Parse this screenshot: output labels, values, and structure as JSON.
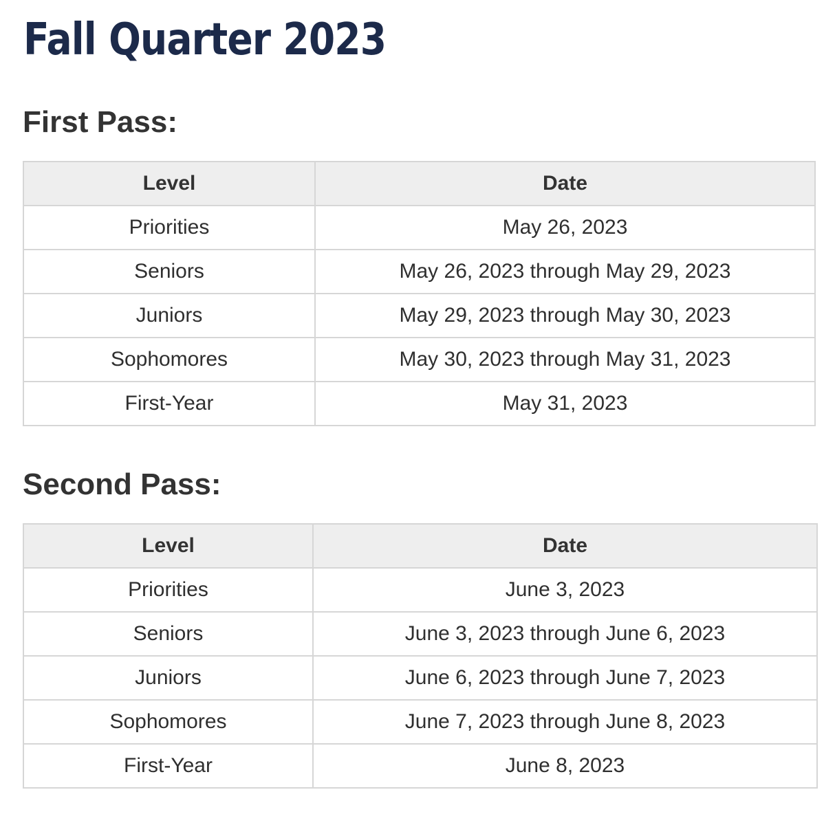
{
  "title": "Fall Quarter 2023",
  "first_pass": {
    "heading": "First Pass:",
    "columns": [
      "Level",
      "Date"
    ],
    "rows": [
      {
        "level": "Priorities",
        "date": "May 26, 2023"
      },
      {
        "level": "Seniors",
        "date": "May 26, 2023 through May 29, 2023"
      },
      {
        "level": "Juniors",
        "date": "May 29, 2023 through May 30, 2023"
      },
      {
        "level": "Sophomores",
        "date": "May 30, 2023 through May 31, 2023"
      },
      {
        "level": "First-Year",
        "date": "May 31, 2023"
      }
    ]
  },
  "second_pass": {
    "heading": "Second Pass:",
    "columns": [
      "Level",
      "Date"
    ],
    "rows": [
      {
        "level": "Priorities",
        "date": "June 3, 2023"
      },
      {
        "level": "Seniors",
        "date": "June 3, 2023 through June 6, 2023"
      },
      {
        "level": "Juniors",
        "date": "June 6, 2023 through June 7, 2023"
      },
      {
        "level": "Sophomores",
        "date": "June 7, 2023 through June 8, 2023"
      },
      {
        "level": "First-Year",
        "date": "June 8, 2023"
      }
    ]
  },
  "colors": {
    "title": "#1c2a4a",
    "heading": "#333333",
    "header_background": "#eeeeee",
    "border": "#d6d6d6"
  }
}
